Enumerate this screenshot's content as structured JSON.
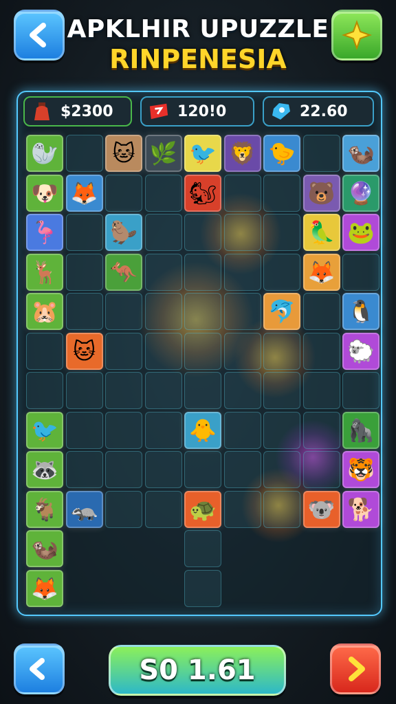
{
  "title": {
    "line1": "APKLHIR UPUZZLE",
    "line2": "RINPENESIA"
  },
  "top_buttons": {
    "back_icon": "chevron-left-icon",
    "star_icon": "sparkle-icon"
  },
  "stats": [
    {
      "icon": "potion-icon",
      "value": "$2300"
    },
    {
      "icon": "ticket-icon",
      "value": "120!0"
    },
    {
      "icon": "gem-icon",
      "value": "22.60"
    }
  ],
  "bottom": {
    "left_icon": "undo-icon",
    "score": "S0 1.61",
    "right_icon": "chevron-right-icon"
  },
  "colors": {
    "board_border": "#54c9ff",
    "title_yellow": "#ffd52a",
    "accent_green": "#8cf05a"
  },
  "tiles": [
    {
      "row": 0,
      "col": 0,
      "animal": "seal",
      "bg": "#5fb33a",
      "emoji": "🦭"
    },
    {
      "row": 0,
      "col": 2,
      "animal": "cat",
      "bg": "#b98a5e",
      "emoji": "🐱"
    },
    {
      "row": 0,
      "col": 3,
      "animal": "plant-creature",
      "bg": "#3c4a55",
      "emoji": "🌿"
    },
    {
      "row": 0,
      "col": 4,
      "animal": "bird",
      "bg": "#e8d84a",
      "emoji": "🐦"
    },
    {
      "row": 0,
      "col": 5,
      "animal": "lion",
      "bg": "#6a4aa8",
      "emoji": "🦁"
    },
    {
      "row": 0,
      "col": 6,
      "animal": "duck",
      "bg": "#3a8ad0",
      "emoji": "🐤"
    },
    {
      "row": 0,
      "col": 8,
      "animal": "otter",
      "bg": "#4aa0d8",
      "emoji": "🦦"
    },
    {
      "row": 1,
      "col": 0,
      "animal": "dog",
      "bg": "#5fb33a",
      "emoji": "🐶"
    },
    {
      "row": 1,
      "col": 1,
      "animal": "fox",
      "bg": "#3a8ad0",
      "emoji": "🦊"
    },
    {
      "row": 1,
      "col": 4,
      "animal": "squirrel",
      "bg": "#d8402a",
      "emoji": "🐿"
    },
    {
      "row": 1,
      "col": 7,
      "animal": "bear",
      "bg": "#7a5ab0",
      "emoji": "🐻"
    },
    {
      "row": 1,
      "col": 8,
      "animal": "orb",
      "bg": "#2a9a6a",
      "emoji": "🔮"
    },
    {
      "row": 2,
      "col": 0,
      "animal": "flamingo",
      "bg": "#4a7ae0",
      "emoji": "🦩"
    },
    {
      "row": 2,
      "col": 2,
      "animal": "meerkat",
      "bg": "#3aa0c8",
      "emoji": "🦫"
    },
    {
      "row": 2,
      "col": 7,
      "animal": "parrot",
      "bg": "#e8c83a",
      "emoji": "🦜"
    },
    {
      "row": 2,
      "col": 8,
      "animal": "frog",
      "bg": "#b04ad8",
      "emoji": "🐸"
    },
    {
      "row": 3,
      "col": 0,
      "animal": "deer",
      "bg": "#5fb33a",
      "emoji": "🦌"
    },
    {
      "row": 3,
      "col": 2,
      "animal": "kangaroo",
      "bg": "#4aa03a",
      "emoji": "🦘"
    },
    {
      "row": 3,
      "col": 7,
      "animal": "fox-kit",
      "bg": "#e8a03a",
      "emoji": "🦊"
    },
    {
      "row": 4,
      "col": 0,
      "animal": "hamster",
      "bg": "#5fb33a",
      "emoji": "🐹"
    },
    {
      "row": 4,
      "col": 6,
      "animal": "dolphin",
      "bg": "#e89a3a",
      "emoji": "🐬"
    },
    {
      "row": 4,
      "col": 8,
      "animal": "penguin",
      "bg": "#3a8ad0",
      "emoji": "🐧"
    },
    {
      "row": 5,
      "col": 1,
      "animal": "kitten",
      "bg": "#e86a2a",
      "emoji": "🐱"
    },
    {
      "row": 5,
      "col": 8,
      "animal": "yeti",
      "bg": "#b04ad8",
      "emoji": "🐑"
    },
    {
      "row": 7,
      "col": 0,
      "animal": "heron",
      "bg": "#5fb33a",
      "emoji": "🐦"
    },
    {
      "row": 7,
      "col": 4,
      "animal": "chick",
      "bg": "#3aa0c8",
      "emoji": "🐥"
    },
    {
      "row": 7,
      "col": 8,
      "animal": "gorilla",
      "bg": "#3aa03a",
      "emoji": "🦍"
    },
    {
      "row": 8,
      "col": 0,
      "animal": "raccoon",
      "bg": "#5fb33a",
      "emoji": "🦝"
    },
    {
      "row": 8,
      "col": 8,
      "animal": "tiger",
      "bg": "#b04ad8",
      "emoji": "🐯"
    },
    {
      "row": 9,
      "col": 0,
      "animal": "goat",
      "bg": "#5fb33a",
      "emoji": "🐐"
    },
    {
      "row": 9,
      "col": 1,
      "animal": "badger",
      "bg": "#2a6ab0",
      "emoji": "🦡"
    },
    {
      "row": 9,
      "col": 4,
      "animal": "turtle",
      "bg": "#e8602a",
      "emoji": "🐢"
    },
    {
      "row": 9,
      "col": 7,
      "animal": "koala",
      "bg": "#e8602a",
      "emoji": "🐨"
    },
    {
      "row": 9,
      "col": 8,
      "animal": "corgi",
      "bg": "#b04ad8",
      "emoji": "🐕"
    },
    {
      "row": 10,
      "col": 0,
      "animal": "weasel",
      "bg": "#5fb33a",
      "emoji": "🦦"
    },
    {
      "row": 11,
      "col": 0,
      "animal": "fox-cub",
      "bg": "#5fb33a",
      "emoji": "🦊"
    }
  ]
}
